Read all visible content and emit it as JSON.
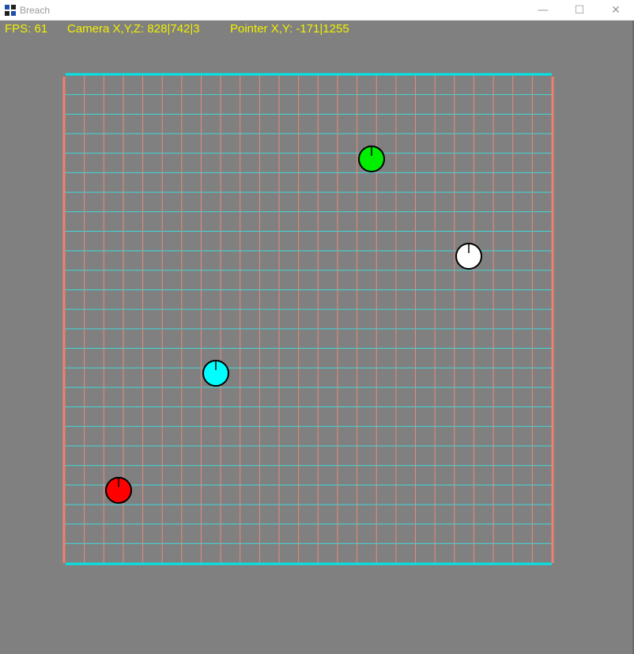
{
  "window": {
    "title": "Breach",
    "minimize_glyph": "—",
    "maximize_glyph": "☐",
    "close_glyph": "✕"
  },
  "hud": {
    "fps": "FPS: 61",
    "camera": "Camera X,Y,Z: 828|742|3",
    "pointer": "Pointer X,Y: -171|1255"
  },
  "colors": {
    "background": "#808080",
    "hud_text": "#f0f000",
    "horizontal_walls": "#00e6e6",
    "vertical_walls": "#f08070",
    "grid_horizontal": "#40d8d8",
    "grid_vertical": "#e88a7a"
  },
  "icons": {
    "app": "breach-app-icon"
  },
  "entities": [
    {
      "name": "player-red",
      "color": "#ff0000"
    },
    {
      "name": "player-cyan",
      "color": "#00ffff"
    },
    {
      "name": "player-green",
      "color": "#00ee00"
    },
    {
      "name": "player-white",
      "color": "#ffffff"
    }
  ]
}
